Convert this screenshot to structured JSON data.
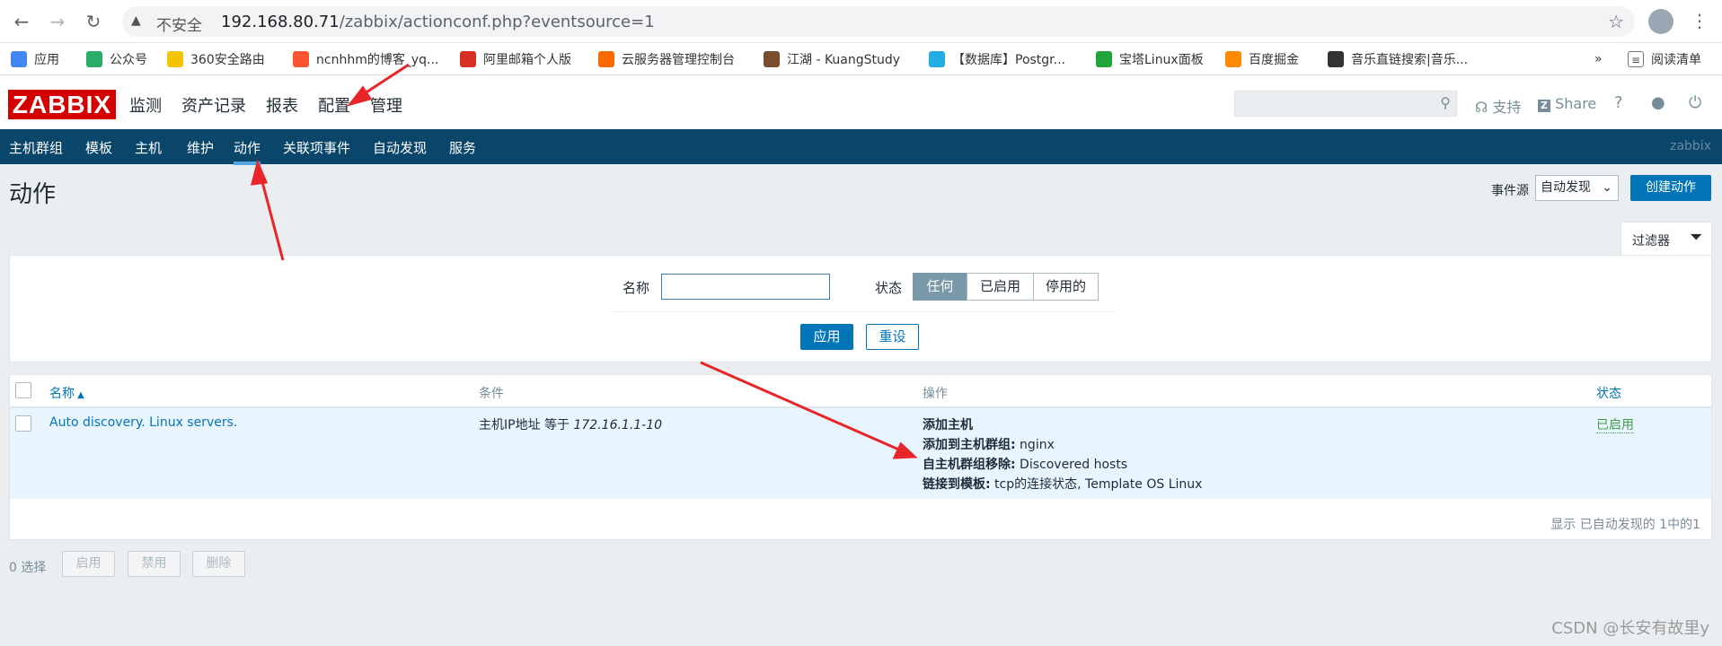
{
  "browser": {
    "insecure_label": "不安全",
    "url_host": "192.168.80.71",
    "url_path": "/zabbix/actionconf.php?eventsource=1",
    "bookmarks": [
      {
        "label": "应用",
        "color": "#4285f4"
      },
      {
        "label": "公众号",
        "color": "#2aae67"
      },
      {
        "label": "360安全路由",
        "color": "#f5c400"
      },
      {
        "label": "ncnhhm的博客_yq...",
        "color": "#fc5531"
      },
      {
        "label": "阿里邮箱个人版",
        "color": "#d93025"
      },
      {
        "label": "云服务器管理控制台",
        "color": "#ff6a00"
      },
      {
        "label": "江湖 - KuangStudy",
        "color": "#7a4e2d"
      },
      {
        "label": "【数据库】Postgr...",
        "color": "#23ade5"
      },
      {
        "label": "宝塔Linux面板",
        "color": "#20a53a"
      },
      {
        "label": "百度掘金",
        "color": "#ff8a00"
      },
      {
        "label": "音乐直链搜索|音乐...",
        "color": "#333333"
      }
    ],
    "more": "»",
    "reading_list": "阅读清单"
  },
  "header": {
    "logo": "ZABBIX",
    "menu": [
      "监测",
      "资产记录",
      "报表",
      "配置",
      "管理"
    ],
    "active_menu_index": 3,
    "support": "支持",
    "share": "Share",
    "help": "?"
  },
  "submenu": {
    "items": [
      "主机群组",
      "模板",
      "主机",
      "维护",
      "动作",
      "关联项事件",
      "自动发现",
      "服务"
    ],
    "active_index": 4,
    "server_name": "zabbix"
  },
  "page": {
    "title": "动作",
    "event_source_label": "事件源",
    "event_source_value": "自动发现",
    "create_button": "创建动作"
  },
  "filter": {
    "tab_label": "过滤器",
    "name_label": "名称",
    "name_value": "",
    "status_label": "状态",
    "status_options": [
      "任何",
      "已启用",
      "停用的"
    ],
    "status_selected": 0,
    "apply": "应用",
    "reset": "重设"
  },
  "table": {
    "headers": {
      "name": "名称",
      "conditions": "条件",
      "operations": "操作",
      "status": "状态"
    },
    "rows": [
      {
        "name": "Auto discovery. Linux servers.",
        "condition_prefix": "主机IP地址 等于 ",
        "condition_value": "172.16.1.1-10",
        "operations": [
          {
            "label": "添加主机",
            "value": ""
          },
          {
            "label": "添加到主机群组:",
            "value": " nginx"
          },
          {
            "label": "自主机群组移除:",
            "value": " Discovered hosts"
          },
          {
            "label": "链接到模板:",
            "value": " tcp的连接状态, Template OS Linux"
          }
        ],
        "status": "已启用"
      }
    ],
    "footer": "显示 已自动发现的 1中的1"
  },
  "actions_bar": {
    "selected_count": "0 选择",
    "buttons": [
      "启用",
      "禁用",
      "删除"
    ]
  },
  "watermark": "CSDN @长安有故里y",
  "colors": {
    "zabbix_red": "#d40000",
    "nav_blue": "#0a466a",
    "primary": "#0275b8",
    "enabled_green": "#429e47",
    "arrow_red": "#e8262a"
  }
}
